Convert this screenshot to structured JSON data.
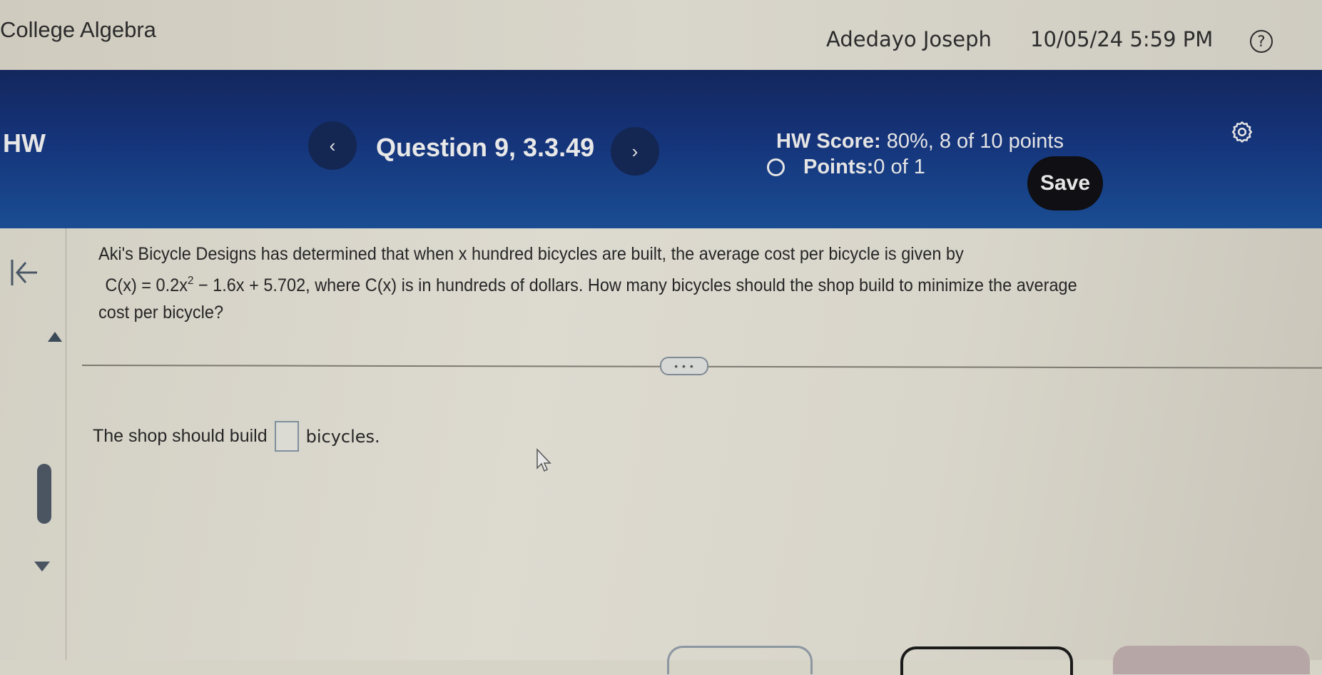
{
  "header": {
    "course_title": "College Algebra",
    "user_name": "Adedayo Joseph",
    "datetime": "10/05/24 5:59 PM",
    "help_icon": "question-circle-icon",
    "help_glyph": "?"
  },
  "banner": {
    "section_label": "HW",
    "prev_glyph": "‹",
    "next_glyph": "›",
    "question_label": "Question 9, 3.3.49",
    "hw_score_label": "HW Score:",
    "hw_score_value": " 80%, 8 of 10 points",
    "points_label": "Points:",
    "points_value": " 0 of 1",
    "settings_icon": "gear-icon",
    "save_label": "Save"
  },
  "question": {
    "line1": "Aki's Bicycle Designs has determined that when x hundred bicycles are built, the average cost per bicycle is given by",
    "formula_left": "C(x) = 0.2x",
    "formula_exp": "2",
    "formula_right": " − 1.6x + 5.702",
    "line2_rest": ", where C(x) is in hundreds of dollars. How many bicycles should the shop build to minimize the average",
    "line3": "cost per bicycle?"
  },
  "more_button": "• • •",
  "answer": {
    "prefix": "The shop should build",
    "value": "",
    "placeholder": "",
    "suffix": "bicycles."
  }
}
